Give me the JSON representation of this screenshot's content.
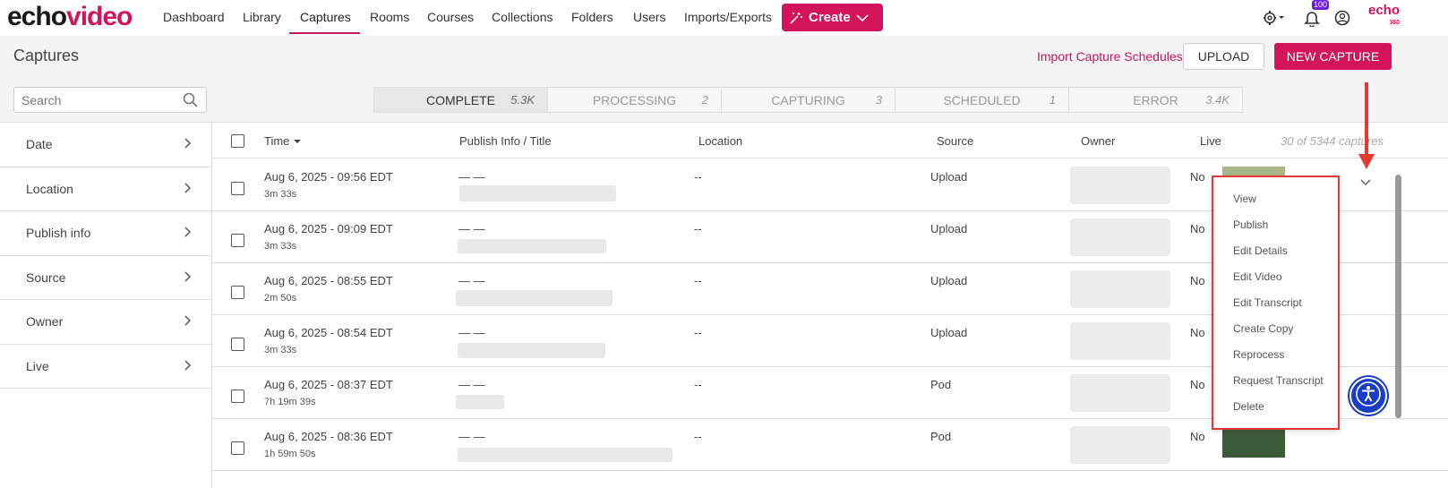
{
  "nav": {
    "logo_echo": "echo",
    "logo_video": "video",
    "items": [
      "Dashboard",
      "Library",
      "Captures",
      "Rooms",
      "Courses",
      "Collections",
      "Folders",
      "Users",
      "Imports/Exports"
    ],
    "active": "Captures",
    "create_label": "Create",
    "notification_count": "100",
    "brand_mark": "echo",
    "brand_mark_sub": "360"
  },
  "header": {
    "title": "Captures",
    "import_link": "Import Capture Schedules",
    "upload_label": "UPLOAD",
    "new_capture_label": "NEW CAPTURE"
  },
  "filters": {
    "search_placeholder": "Search",
    "tabs": [
      {
        "label": "COMPLETE",
        "count": "5.3K",
        "active": true
      },
      {
        "label": "PROCESSING",
        "count": "2",
        "active": false
      },
      {
        "label": "CAPTURING",
        "count": "3",
        "active": false
      },
      {
        "label": "SCHEDULED",
        "count": "1",
        "active": false
      },
      {
        "label": "ERROR",
        "count": "3.4K",
        "active": false
      }
    ]
  },
  "sidebar": {
    "items": [
      "Date",
      "Location",
      "Publish info",
      "Source",
      "Owner",
      "Live"
    ]
  },
  "table": {
    "columns": {
      "time": "Time",
      "publish": "Publish Info / Title",
      "location": "Location",
      "source": "Source",
      "owner": "Owner",
      "live": "Live"
    },
    "count_text": "30 of 5344 captures",
    "rows": [
      {
        "time": "Aug 6, 2025 - 09:56 EDT",
        "duration": "3m 33s",
        "publish": "— —",
        "location": "--",
        "source": "Upload",
        "live": "No"
      },
      {
        "time": "Aug 6, 2025 - 09:09 EDT",
        "duration": "3m 33s",
        "publish": "— —",
        "location": "--",
        "source": "Upload",
        "live": "No"
      },
      {
        "time": "Aug 6, 2025 - 08:55 EDT",
        "duration": "2m 50s",
        "publish": "— —",
        "location": "--",
        "source": "Upload",
        "live": "No"
      },
      {
        "time": "Aug 6, 2025 - 08:54 EDT",
        "duration": "3m 33s",
        "publish": "— —",
        "location": "--",
        "source": "Upload",
        "live": "No"
      },
      {
        "time": "Aug 6, 2025 - 08:37 EDT",
        "duration": "7h 19m 39s",
        "publish": "— —",
        "location": "--",
        "source": "Pod",
        "live": "No"
      },
      {
        "time": "Aug 6, 2025 - 08:36 EDT",
        "duration": "1h 59m 50s",
        "publish": "— —",
        "location": "--",
        "source": "Pod",
        "live": "No"
      }
    ]
  },
  "menu": {
    "items": [
      "View",
      "Publish",
      "Edit Details",
      "Edit Video",
      "Edit Transcript",
      "Create Copy",
      "Reprocess",
      "Request Transcript",
      "Delete"
    ]
  },
  "colors": {
    "brand": "#d4145a",
    "annotation": "#e53935",
    "accessibility": "#1a3dc7"
  }
}
